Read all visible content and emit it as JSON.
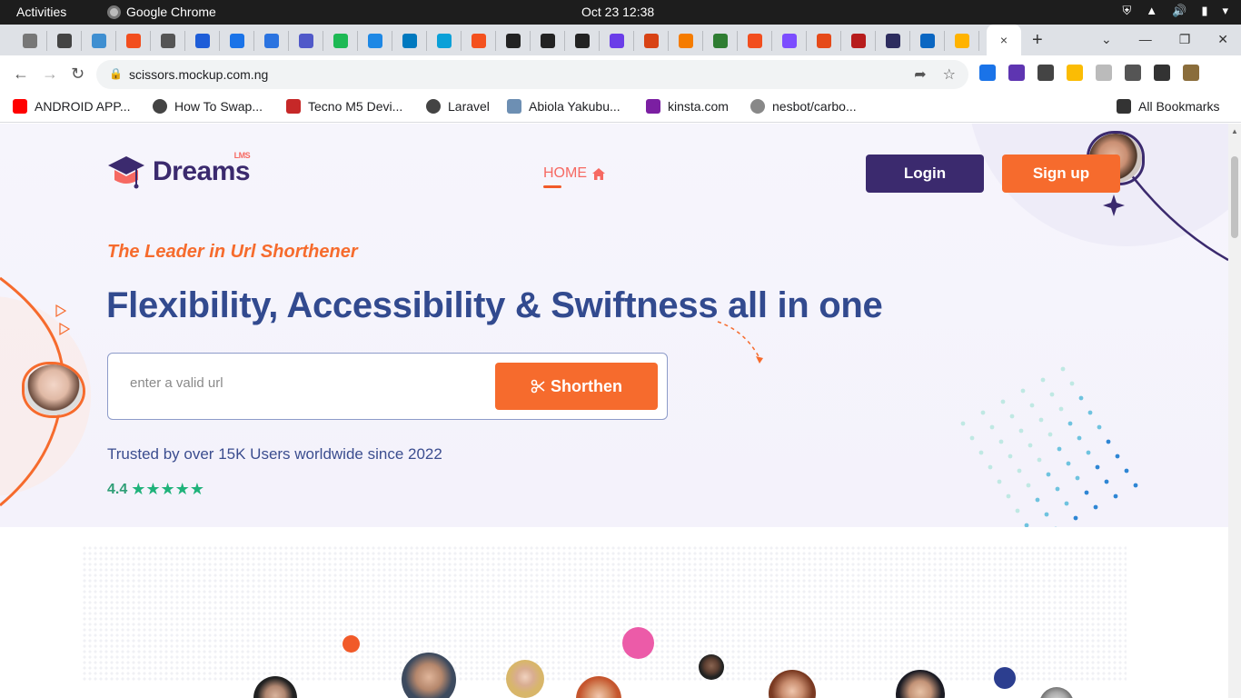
{
  "os": {
    "activities": "Activities",
    "app_name": "Google Chrome",
    "clock": "Oct 23  12:38"
  },
  "browser": {
    "url": "scissors.mockup.com.ng",
    "tab_close": "×",
    "new_tab": "+",
    "tab_favicons": [
      "#777",
      "#444",
      "#3f8fd1",
      "#f24e1e",
      "#555",
      "#1e5dd8",
      "#1a73e8",
      "#2a73e0",
      "#5059c9",
      "#1db954",
      "#1e88e5",
      "#0079bf",
      "#0aa0d8",
      "#f4511e",
      "#222",
      "#222",
      "#222",
      "#6a3de8",
      "#d84315",
      "#f57c00",
      "#2e7d32",
      "#f24e1e",
      "#7c4dff",
      "#e64a19",
      "#b71c1c",
      "#2d2d5f",
      "#0a66c2",
      "#ffb300"
    ],
    "extension_colors": [
      "#1a73e8",
      "#5e35b1",
      "#444",
      "#fbbc04",
      "#bbb",
      "#555",
      "#333",
      "#8a6d3b"
    ]
  },
  "bookmarks": [
    {
      "label": "ANDROID APP...",
      "color": "#ff0000"
    },
    {
      "label": "How To Swap...",
      "color": "#444"
    },
    {
      "label": "Tecno M5 Devi...",
      "color": "#c62828"
    },
    {
      "label": "Laravel",
      "color": "#444"
    },
    {
      "label": "Abiola Yakubu...",
      "color": "#6d8fb3"
    },
    {
      "label": "kinsta.com",
      "color": "#7b1fa2"
    },
    {
      "label": "nesbot/carbo...",
      "color": "#888"
    },
    {
      "label": "All Bookmarks",
      "color": "#333"
    }
  ],
  "site": {
    "logo_word": "Dreams",
    "logo_sup": "LMS",
    "nav_home": "HOME",
    "login": "Login",
    "signup": "Sign up",
    "tagline": "The Leader in Url Shorthener",
    "headline": "Flexibility, Accessibility & Swiftness all in one",
    "url_placeholder": "enter a valid url",
    "shorten": "Shorthen",
    "trusted": "Trusted by over 15K Users worldwide since 2022",
    "rating": "4.4",
    "stars": 5
  },
  "colors": {
    "primary": "#3b2a6e",
    "accent": "#f66b2d",
    "heading": "#324a8f",
    "rating_green": "#1fb27a"
  }
}
